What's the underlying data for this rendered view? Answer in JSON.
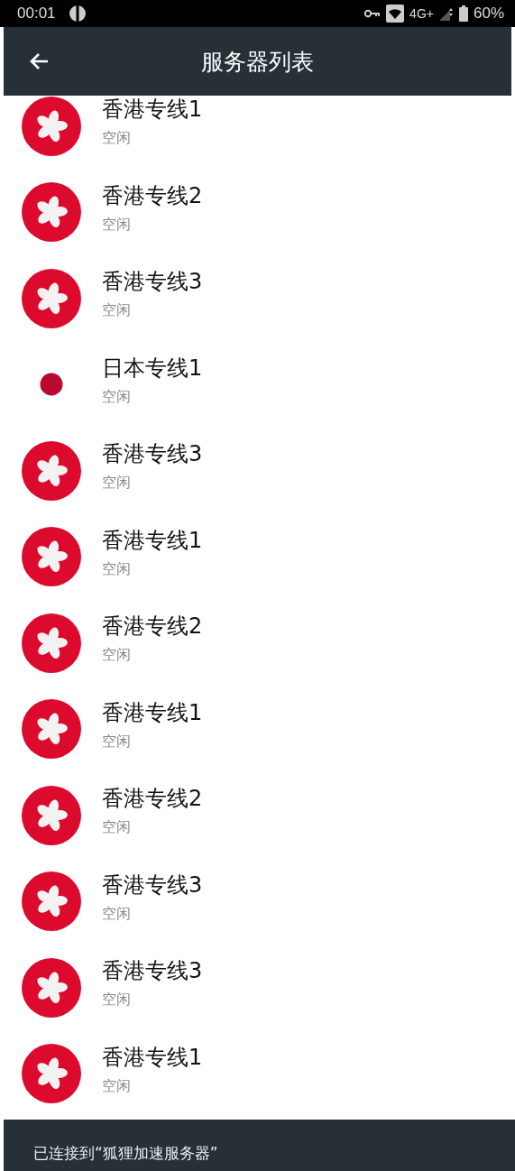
{
  "status_bar": {
    "time": "00:01",
    "network": "4G+",
    "battery": "60%"
  },
  "app_bar": {
    "title": "服务器列表"
  },
  "servers": [
    {
      "name": "香港专线1",
      "status": "空闲",
      "kind": "hk"
    },
    {
      "name": "香港专线2",
      "status": "空闲",
      "kind": "hk"
    },
    {
      "name": "香港专线3",
      "status": "空闲",
      "kind": "hk"
    },
    {
      "name": "日本专线1",
      "status": "空闲",
      "kind": "jp"
    },
    {
      "name": "香港专线3",
      "status": "空闲",
      "kind": "hk"
    },
    {
      "name": "香港专线1",
      "status": "空闲",
      "kind": "hk"
    },
    {
      "name": "香港专线2",
      "status": "空闲",
      "kind": "hk"
    },
    {
      "name": "香港专线1",
      "status": "空闲",
      "kind": "hk"
    },
    {
      "name": "香港专线2",
      "status": "空闲",
      "kind": "hk"
    },
    {
      "name": "香港专线3",
      "status": "空闲",
      "kind": "hk"
    },
    {
      "name": "香港专线3",
      "status": "空闲",
      "kind": "hk"
    },
    {
      "name": "香港专线1",
      "status": "空闲",
      "kind": "hk"
    }
  ],
  "snackbar": {
    "message": "已连接到“狐狸加速服务器”"
  }
}
